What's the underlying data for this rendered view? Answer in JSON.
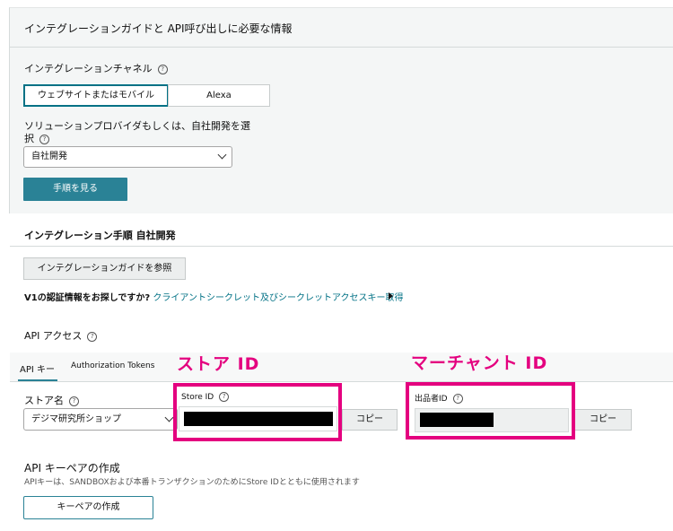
{
  "guide": {
    "title": "インテグレーションガイドと API呼び出しに必要な情報",
    "channel_label": "インテグレーションチャネル",
    "channel_options": [
      "ウェブサイトまたはモバイル",
      "Alexa"
    ],
    "provider_label_line1": "ソリューションプロバイダもしくは、自社開発を選",
    "provider_label_line2": "択",
    "provider_value": "自社開発",
    "steps_button": "手順を見る"
  },
  "integration": {
    "title": "インテグレーション手順 自社開発",
    "guide_button": "インテグレーションガイドを参照",
    "v1_question": "V1の認証情報をお探しですか?",
    "v1_link": "クライアントシークレット及びシークレットアクセスキー取得"
  },
  "api_access": {
    "title": "API アクセス",
    "tabs": [
      "API キー",
      "Authorization Tokens"
    ],
    "store_name_label": "ストア名",
    "store_name_value": "デジマ研究所ショップ",
    "store_id_label": "Store ID",
    "copy_label": "コピー",
    "seller_id_label": "出品者ID",
    "copy_label_2": "コピー"
  },
  "annotations": {
    "store_id": "ストア ID",
    "merchant_id": "マーチャント ID"
  },
  "keypair": {
    "title": "API キーペアの作成",
    "description": "APIキーは、SANDBOXおよび本番トランザクションのためにStore IDとともに使用されます",
    "create_button": "キーペアの作成"
  },
  "icons": {
    "help": "help-circle-icon",
    "select_arrow": "chevron-down-icon",
    "link_arrow": "triangle-right-icon"
  },
  "colors": {
    "primary_button": "#2a8296",
    "link": "#007185",
    "annotation": "#e4007f"
  }
}
